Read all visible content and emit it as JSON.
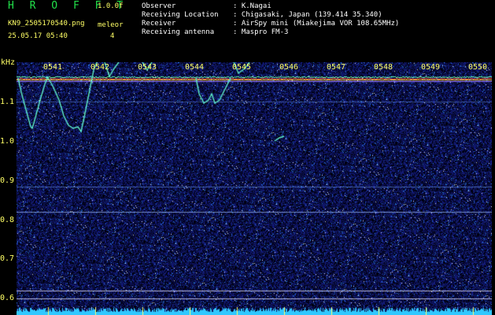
{
  "header": {
    "app_title": "H R O F F T",
    "version": "1.0.0f",
    "filename": "KN9_2505170540.png",
    "mode": "meleor",
    "datetime": "25.05.17 05:40",
    "count": "4"
  },
  "info": [
    {
      "label": "Observer",
      "value": ": K.Nagai"
    },
    {
      "label": "Receiving Location",
      "value": ": Chigasaki, Japan (139.414 35.340)"
    },
    {
      "label": "Receiver",
      "value": ": AirSpy mini (Miakejima VOR 108.65MHz)"
    },
    {
      "label": "Receiving antenna",
      "value": ": Maspro FM-3"
    }
  ],
  "spectrogram": {
    "y_unit": "kHz",
    "y_ticks": [
      "1.1",
      "1.0",
      "0.9",
      "0.8",
      "0.7",
      "0.6"
    ],
    "x_ticks": [
      "0541",
      "0542",
      "0543",
      "0544",
      "0545",
      "0546",
      "0547",
      "0548",
      "0549",
      "0550"
    ],
    "colors": {
      "label": "#ffff66",
      "title": "#22e04a",
      "background": "#000000",
      "noise": "#1a1f7a",
      "trace": "#5ff0c8",
      "carrier": "#ff3b3b",
      "baseline": "#30c8ff"
    }
  }
}
